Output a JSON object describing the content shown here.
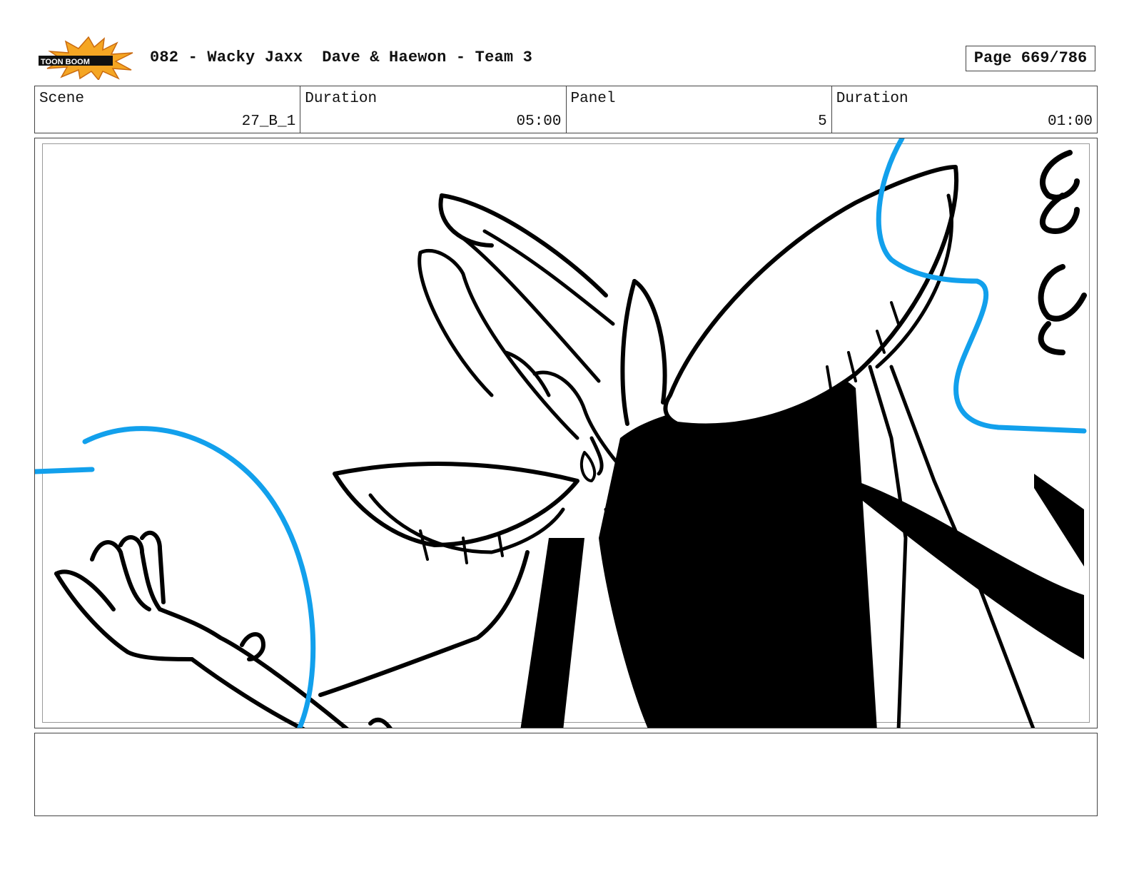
{
  "header": {
    "logo_text": "TOON BOOM",
    "title": "082 - Wacky Jaxx  Dave & Haewon - Team 3",
    "page": "Page 669/786"
  },
  "info": {
    "scene_label": "Scene",
    "scene_value": "27_B_1",
    "duration_label": "Duration",
    "duration_value": "05:00",
    "panel_label": "Panel",
    "panel_value": "5",
    "panel_duration_label": "Duration",
    "panel_duration_value": "01:00"
  },
  "colors": {
    "line": "#000000",
    "guide": "#12a0ec",
    "logo_burst": "#f5a623"
  },
  "notes": ""
}
